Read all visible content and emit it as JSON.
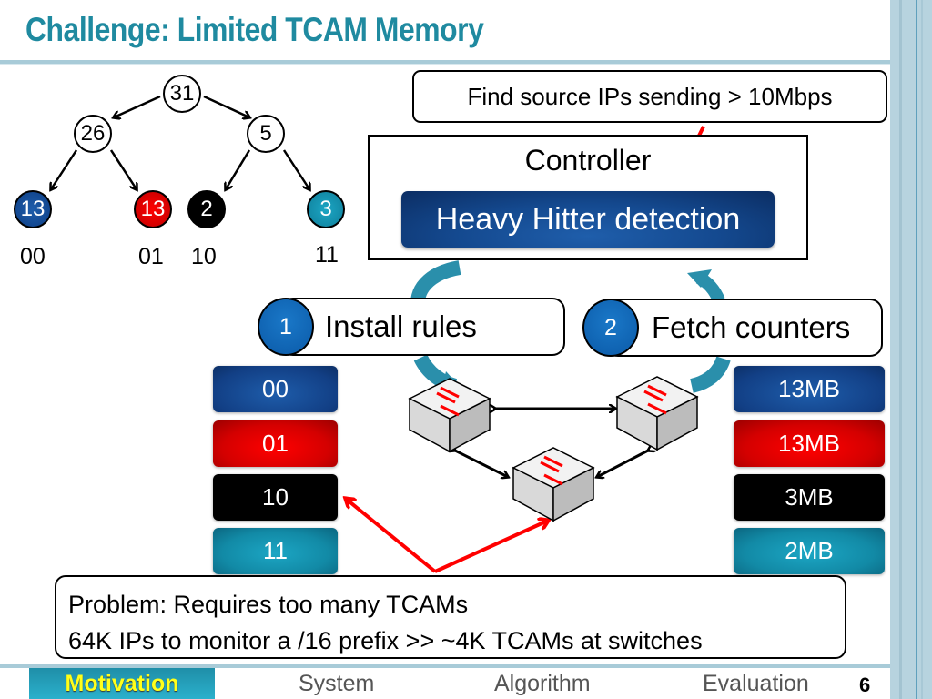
{
  "slide": {
    "title": "Challenge: Limited TCAM Memory",
    "page_number": "6"
  },
  "tree": {
    "root": {
      "value": "31"
    },
    "internal": [
      {
        "value": "26"
      },
      {
        "value": "5"
      }
    ],
    "leaves": [
      {
        "value": "13",
        "prefix": "00",
        "color": "#0e3f86"
      },
      {
        "value": "13",
        "prefix": "01",
        "color": "#d40000"
      },
      {
        "value": "2",
        "prefix": "10",
        "color": "#000000"
      },
      {
        "value": "3",
        "prefix": "11",
        "color": "#1490ae"
      }
    ]
  },
  "query": "Find source IPs sending > 10Mbps",
  "controller": {
    "label": "Controller",
    "module": "Heavy Hitter detection"
  },
  "steps": [
    {
      "number": "1",
      "label": "Install rules"
    },
    {
      "number": "2",
      "label": "Fetch counters"
    }
  ],
  "rules": [
    "00",
    "01",
    "10",
    "11"
  ],
  "counters": [
    "13MB",
    "13MB",
    "3MB",
    "2MB"
  ],
  "problem": {
    "line1": "Problem: Requires too many TCAMs",
    "line2": "64K IPs to monitor a /16 prefix >> ~4K TCAMs at switches"
  },
  "nav": [
    {
      "label": "Motivation",
      "active": true
    },
    {
      "label": "System",
      "active": false
    },
    {
      "label": "Algorithm",
      "active": false
    },
    {
      "label": "Evaluation",
      "active": false
    }
  ],
  "colors": {
    "title": "#1f8aa0",
    "accent_blue": "#0e3f86",
    "accent_red": "#d40000",
    "accent_teal": "#1490ae",
    "nav_active_text": "#ffff1a",
    "arrow_red": "#ff0000"
  }
}
